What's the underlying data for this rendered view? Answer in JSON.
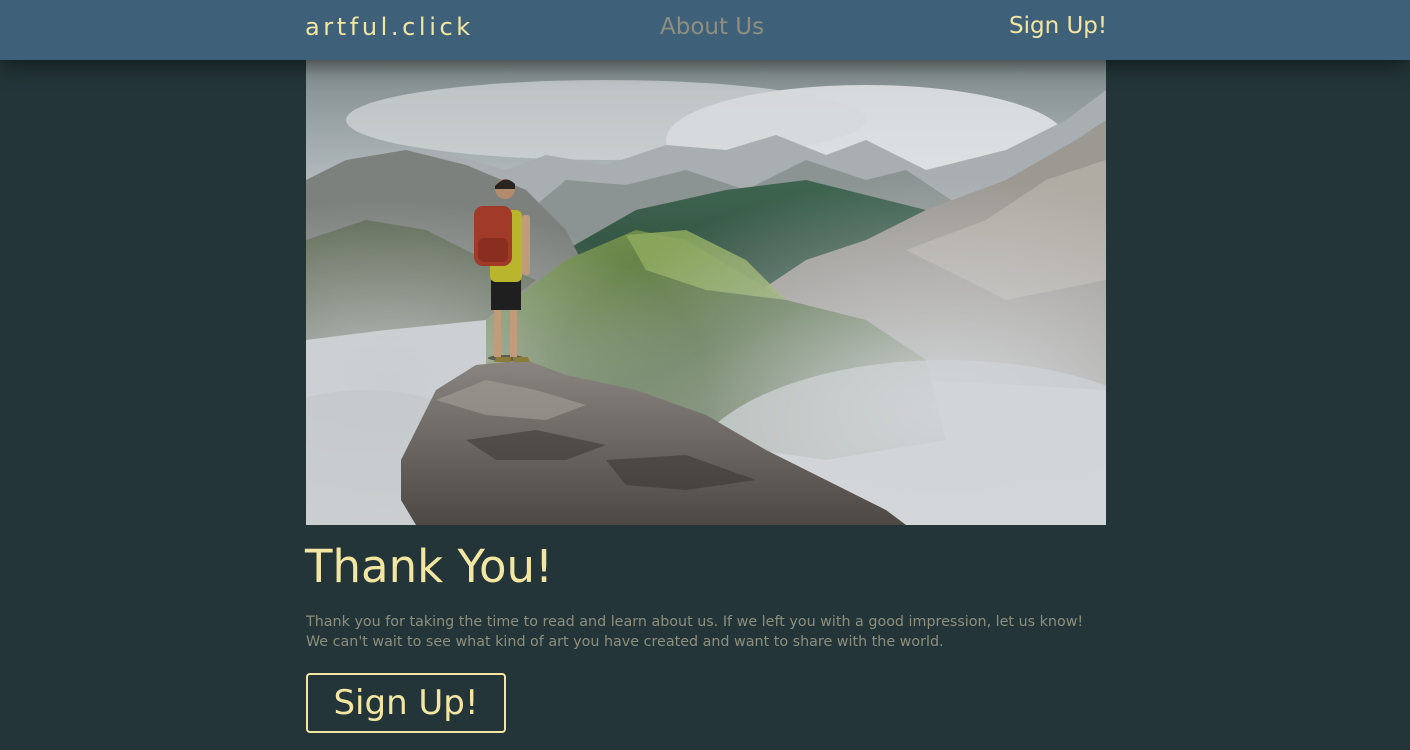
{
  "nav": {
    "brand": "artful.click",
    "about": "About Us",
    "signup": "Sign Up!"
  },
  "hero": {
    "image_alt": "Hiker with red backpack standing on a rocky outcrop overlooking misty mountains"
  },
  "content": {
    "title": "Thank You!",
    "body": "Thank you for taking the time to read and learn about us. If we left you with a good impression, let us know! We can't wait to see what kind of art you have created and want to share with the world.",
    "cta": "Sign Up!"
  },
  "colors": {
    "background": "#233538",
    "navbar": "#3e6079",
    "accent": "#f3e6a2",
    "muted_text": "#8d8f7d"
  }
}
